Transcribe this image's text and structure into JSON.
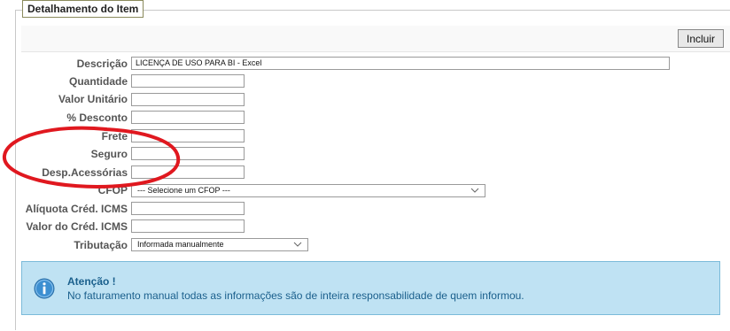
{
  "fieldset": {
    "legend": "Detalhamento do Item"
  },
  "toolbar": {
    "include_label": "Incluir"
  },
  "form": {
    "descricao": {
      "label": "Descrição",
      "value": "LICENÇA DE USO PARA BI - Excel"
    },
    "quantidade": {
      "label": "Quantidade",
      "value": ""
    },
    "valor_unitario": {
      "label": "Valor Unitário",
      "value": ""
    },
    "desconto": {
      "label": "% Desconto",
      "value": ""
    },
    "frete": {
      "label": "Frete",
      "value": ""
    },
    "seguro": {
      "label": "Seguro",
      "value": ""
    },
    "desp_acessorias": {
      "label": "Desp.Acessórias",
      "value": ""
    },
    "cfop": {
      "label": "CFOP",
      "selected": "--- Selecione um CFOP ---"
    },
    "aliquota_icms": {
      "label": "Alíquota Créd. ICMS",
      "value": ""
    },
    "valor_icms": {
      "label": "Valor do Créd. ICMS",
      "value": ""
    },
    "tributacao": {
      "label": "Tributação",
      "selected": "Informada manualmente"
    }
  },
  "alert": {
    "title": "Atenção !",
    "message": "No faturamento manual todas as informações são de inteira responsabilidade de quem informou.",
    "icon": "info-icon"
  },
  "colors": {
    "alert_bg": "#bfe2f3",
    "alert_text": "#1a5f8c",
    "annotation": "#e0181f",
    "label_text": "#555555"
  }
}
